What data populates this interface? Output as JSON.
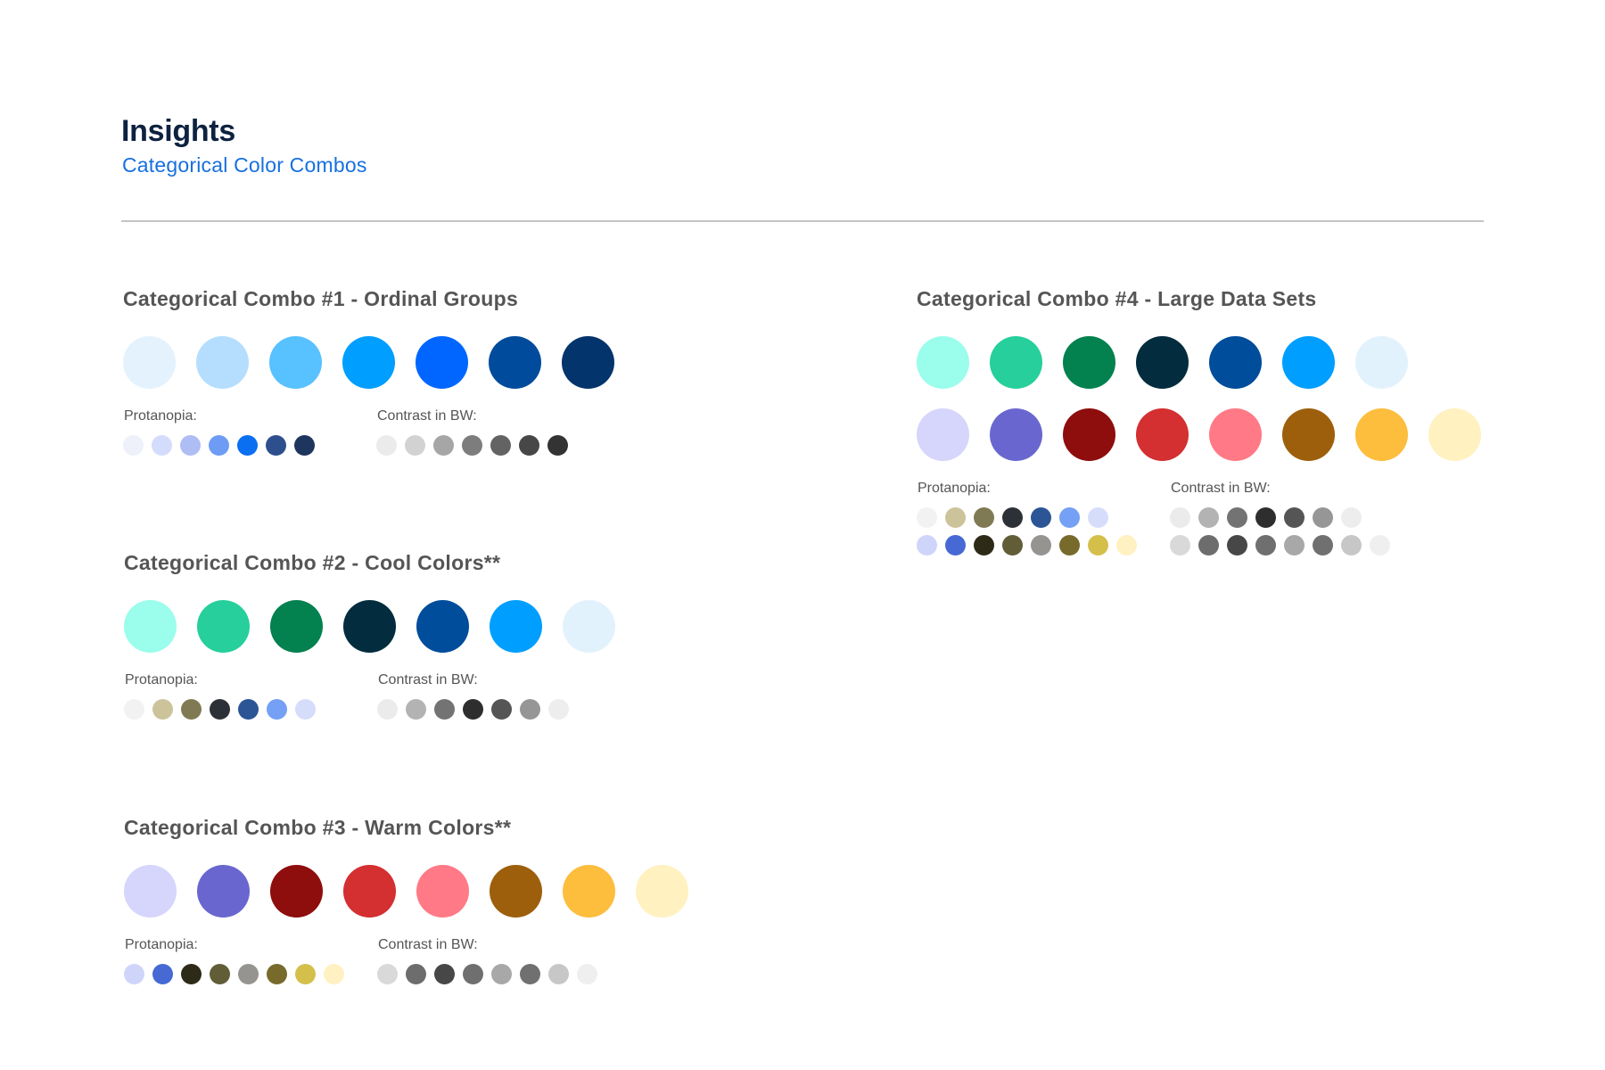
{
  "header": {
    "title": "Insights",
    "subtitle": "Categorical Color Combos"
  },
  "combos": [
    {
      "title": "Categorical Combo #1 - Ordinal Groups",
      "main_rows": [
        [
          "#e3f2fd",
          "#b5defe",
          "#58c1ff",
          "#009eff",
          "#0066ff",
          "#004b9c",
          "#03346b"
        ]
      ],
      "protanopia_label": "Protanopia:",
      "protanopia_rows": [
        [
          "#eef0fa",
          "#d4dcfb",
          "#aebdf4",
          "#6e9cf5",
          "#0b6ff2",
          "#2e4f8d",
          "#1e355e"
        ]
      ],
      "bw_label": "Contrast in BW:",
      "bw_rows": [
        [
          "#ebebeb",
          "#d2d2d2",
          "#a6a6a6",
          "#7d7d7d",
          "#636363",
          "#474747",
          "#333333"
        ]
      ]
    },
    {
      "title": "Categorical Combo #2 - Cool Colors**",
      "main_rows": [
        [
          "#9bfdec",
          "#26cf9b",
          "#03814f",
          "#032d3e",
          "#004d9b",
          "#009eff",
          "#e2f2fd"
        ]
      ],
      "protanopia_label": "Protanopia:",
      "protanopia_rows": [
        [
          "#f2f2f2",
          "#cdc39b",
          "#807a54",
          "#2c3138",
          "#2c5596",
          "#74a0f5",
          "#d6ddfb"
        ]
      ],
      "bw_label": "Contrast in BW:",
      "bw_rows": [
        [
          "#ebebeb",
          "#b3b3b3",
          "#737373",
          "#2e2e2e",
          "#555555",
          "#969696",
          "#ededed"
        ]
      ]
    },
    {
      "title": "Categorical Combo #3 - Warm Colors**",
      "main_rows": [
        [
          "#d6d5fb",
          "#6967cf",
          "#8e0d0d",
          "#d42f31",
          "#ff7a86",
          "#9d5f0c",
          "#fdbd3d",
          "#fff1c0"
        ]
      ],
      "protanopia_label": "Protanopia:",
      "protanopia_rows": [
        [
          "#cfd5fa",
          "#4669d4",
          "#2d2a17",
          "#615d36",
          "#959490",
          "#776a2b",
          "#d5bf4b",
          "#fff1c1"
        ]
      ],
      "bw_label": "Contrast in BW:",
      "bw_rows": [
        [
          "#d9d9d9",
          "#6d6d6d",
          "#474747",
          "#6f6f6f",
          "#a8a8a8",
          "#707070",
          "#c7c7c7",
          "#efefef"
        ]
      ]
    },
    {
      "title": "Categorical Combo #4 - Large Data Sets",
      "main_rows": [
        [
          "#9bfdec",
          "#26cf9b",
          "#03814f",
          "#032d3e",
          "#004d9b",
          "#009eff",
          "#e2f2fd"
        ],
        [
          "#d6d5fb",
          "#6967cf",
          "#8e0d0d",
          "#d42f31",
          "#ff7a86",
          "#9d5f0c",
          "#fdbd3d",
          "#fff1c0"
        ]
      ],
      "protanopia_label": "Protanopia:",
      "protanopia_rows": [
        [
          "#f2f2f2",
          "#cdc39b",
          "#807a54",
          "#2c3138",
          "#2c5596",
          "#74a0f5",
          "#d6ddfb"
        ],
        [
          "#cfd5fa",
          "#4669d4",
          "#2d2a17",
          "#615d36",
          "#959490",
          "#776a2b",
          "#d5bf4b",
          "#fff1c1"
        ]
      ],
      "bw_label": "Contrast in BW:",
      "bw_rows": [
        [
          "#ebebeb",
          "#b3b3b3",
          "#737373",
          "#2e2e2e",
          "#555555",
          "#969696",
          "#ededed"
        ],
        [
          "#d9d9d9",
          "#6d6d6d",
          "#474747",
          "#6f6f6f",
          "#a8a8a8",
          "#707070",
          "#c7c7c7",
          "#efefef"
        ]
      ]
    }
  ]
}
